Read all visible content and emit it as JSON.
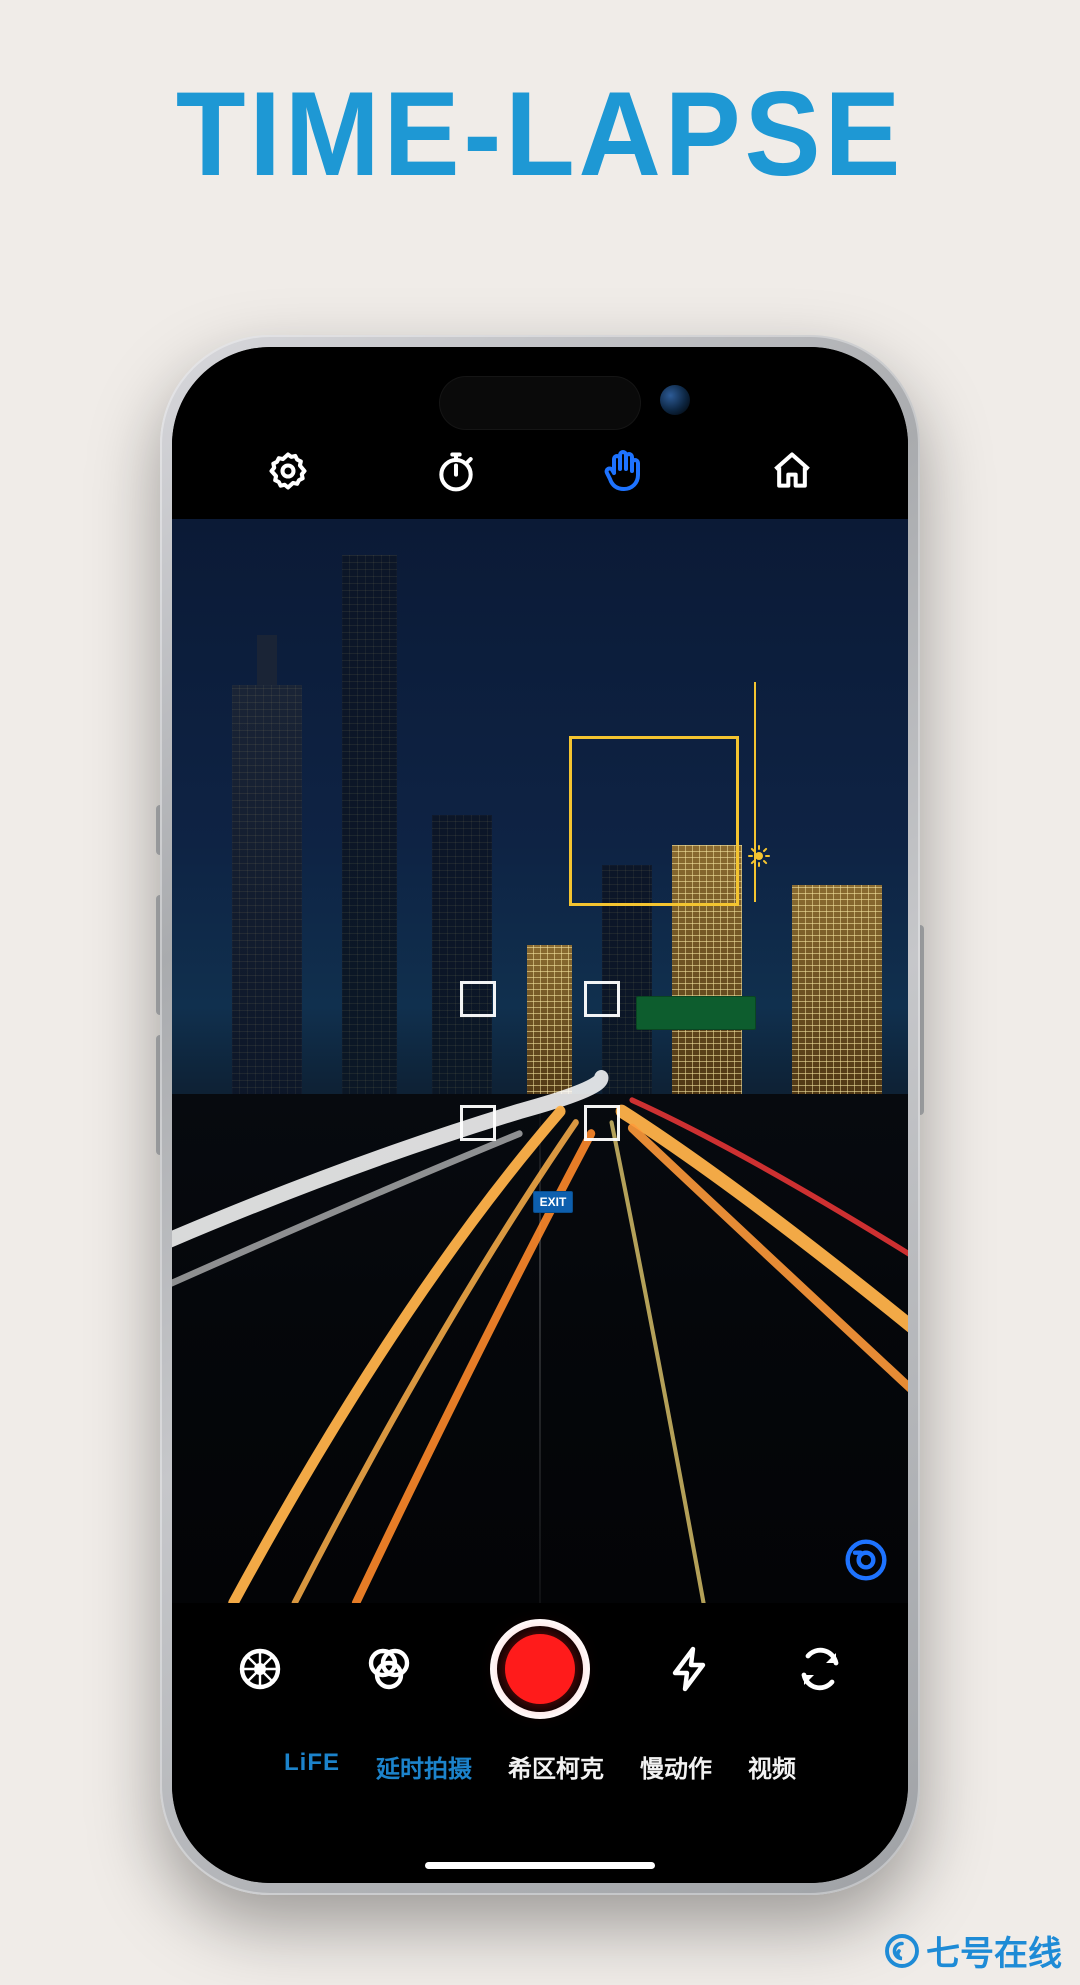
{
  "hero": {
    "title": "TIME-LAPSE"
  },
  "topbar": {
    "settings_icon": "settings",
    "timer_icon": "timer",
    "hand_icon": "hand",
    "home_icon": "home"
  },
  "viewfinder": {
    "exit_sign": "EXIT",
    "watermark": "app-logo"
  },
  "controls": {
    "color_icon": "color-wheel",
    "filter_icon": "filters",
    "record_icon": "record",
    "flash_icon": "flash",
    "switch_icon": "switch-camera"
  },
  "modes": {
    "brand": "LiFE",
    "items": [
      "延时拍摄",
      "希区柯克",
      "慢动作",
      "视频"
    ],
    "active_index": 0
  },
  "footer": {
    "text": "七号在线"
  },
  "colors": {
    "accent": "#1e98d4",
    "interactive_blue": "#1e73ff",
    "focus_yellow": "#f4c430",
    "record_red": "#ff1b1b"
  }
}
